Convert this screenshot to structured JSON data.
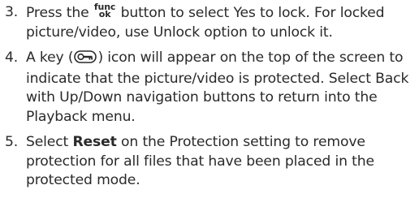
{
  "steps": [
    {
      "number": "3.",
      "before_button": "Press the",
      "button_top": "func",
      "button_bottom": "ok",
      "after_button": "button to select Yes to lock. For locked picture/video, use Unlock option to unlock it."
    },
    {
      "number": "4.",
      "before_icon": "A key (",
      "icon": "key-icon",
      "after_icon": ") icon will appear on the top of the screen to indicate that the picture/video is protected. Select Back with Up/Down navigation buttons to return into the Playback menu."
    },
    {
      "number": "5.",
      "before_bold": "Select",
      "bold": "Reset",
      "after_bold": "on the Protection setting to remove protection for all files that have been placed in the protected mode."
    }
  ]
}
